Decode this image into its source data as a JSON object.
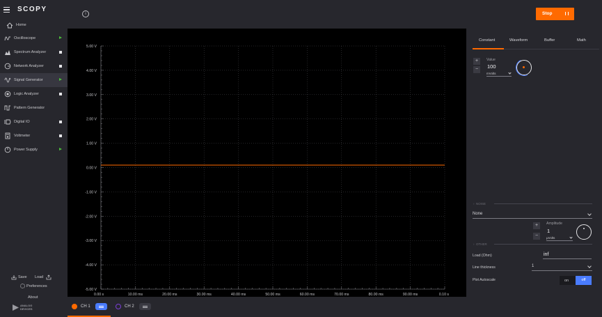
{
  "app": {
    "logo": "SCOPY"
  },
  "sidebar": {
    "home": "Home",
    "items": [
      {
        "label": "Oscilloscope",
        "icon": "oscilloscope-icon",
        "state": "running"
      },
      {
        "label": "Spectrum Analyzer",
        "icon": "spectrum-analyzer-icon",
        "state": "stopped"
      },
      {
        "label": "Network Analyzer",
        "icon": "network-analyzer-icon",
        "state": "stopped"
      },
      {
        "label": "Signal Generator",
        "icon": "signal-generator-icon",
        "state": "running",
        "active": true
      },
      {
        "label": "Logic Analyzer",
        "icon": "logic-analyzer-icon",
        "state": "stopped"
      },
      {
        "label": "Pattern Generator",
        "icon": "pattern-generator-icon",
        "state": "none"
      },
      {
        "label": "Digital IO",
        "icon": "digital-io-icon",
        "state": "stopped"
      },
      {
        "label": "Voltmeter",
        "icon": "voltmeter-icon",
        "state": "stopped"
      },
      {
        "label": "Power Supply",
        "icon": "power-supply-icon",
        "state": "running"
      }
    ],
    "save": "Save",
    "load": "Load",
    "preferences": "Preferences",
    "about": "About",
    "vendor": "ANALOG DEVICES"
  },
  "toolbar": {
    "run_button": "Stop"
  },
  "plot": {
    "y_ticks": [
      "5.00 V",
      "4.00 V",
      "3.00 V",
      "2.00 V",
      "1.00 V",
      "0.00 V",
      "-1.00 V",
      "-2.00 V",
      "-3.00 V",
      "-4.00 V",
      "-5.00 V"
    ],
    "x_ticks": [
      "0.00 s",
      "10.00 ms",
      "20.00 ms",
      "30.00 ms",
      "40.00 ms",
      "50.00 ms",
      "60.00 ms",
      "70.00 ms",
      "80.00 ms",
      "90.00 ms",
      "0.10 s"
    ],
    "y_range": [
      -5,
      5
    ],
    "x_range": [
      0,
      0.1
    ],
    "trace_value_v": 0.1,
    "trace_color": "#ff6a00"
  },
  "channels": [
    {
      "label": "CH 1",
      "color": "#ff6a00",
      "active": true
    },
    {
      "label": "CH 2",
      "color": "#7a3ed6",
      "active": false
    }
  ],
  "panel": {
    "tabs": [
      "Constant",
      "Waveform",
      "Buffer",
      "Math"
    ],
    "active_tab": "Constant",
    "value_label": "Value",
    "value": "100",
    "value_unit": "mVolts",
    "noise_header": "NOISE",
    "noise_type": "None",
    "amplitude_label": "Amplitude",
    "amplitude_value": "1",
    "amplitude_unit": "μVolts",
    "other_header": "OTHER",
    "load_label": "Load (Ohm)",
    "load_value": "inf",
    "thickness_label": "Line thickness",
    "thickness_value": "1",
    "autoscale_label": "Plot Autoscale",
    "autoscale_on": "on",
    "autoscale_off": "off",
    "autoscale_state": "off"
  },
  "colors": {
    "accent": "#ff6a00",
    "toggle_blue": "#4a7cff",
    "run_green": "#4cbf3b"
  }
}
